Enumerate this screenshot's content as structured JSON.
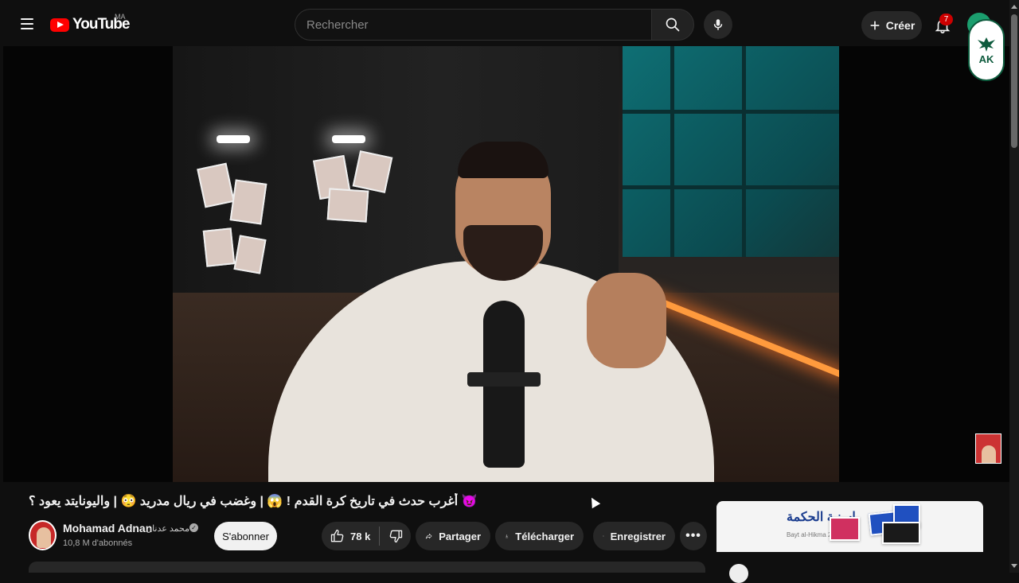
{
  "header": {
    "logo_text": "YouTube",
    "country_code": "MA",
    "search_placeholder": "Rechercher",
    "create_label": "Créer",
    "notification_count": "7"
  },
  "channel_watermark": {
    "letters": "AK"
  },
  "video": {
    "title": "😈 أغرب حدث في تاريخ كرة القدم ! 😱 | وغضب في ريال مدريد 😳 | واليونايتد يعود ؟",
    "channel_name": "Mohamad Adnan",
    "channel_name_ar": "محمد عدنان",
    "subscribers": "10,8 M d'abonnés",
    "subscribe_label": "S'abonner",
    "likes": "78 k",
    "share_label": "Partager",
    "download_label": "Télécharger",
    "save_label": "Enregistrer",
    "more_label": "•••"
  },
  "ad": {
    "brand": "إسنبة الحكمة",
    "sub": "Bayt al-Hikma 2.0"
  },
  "colors": {
    "background": "#0f0f0f",
    "accent": "#ff0000",
    "pill": "#272727",
    "subscribe_bg": "#f1f1f1",
    "badge": "#cc0000"
  },
  "icons": [
    "menu-icon",
    "search-icon",
    "mic-icon",
    "plus-icon",
    "bell-icon",
    "thumbs-up-icon",
    "thumbs-down-icon",
    "share-icon",
    "download-icon",
    "bookmark-icon",
    "more-icon",
    "verified-icon"
  ]
}
